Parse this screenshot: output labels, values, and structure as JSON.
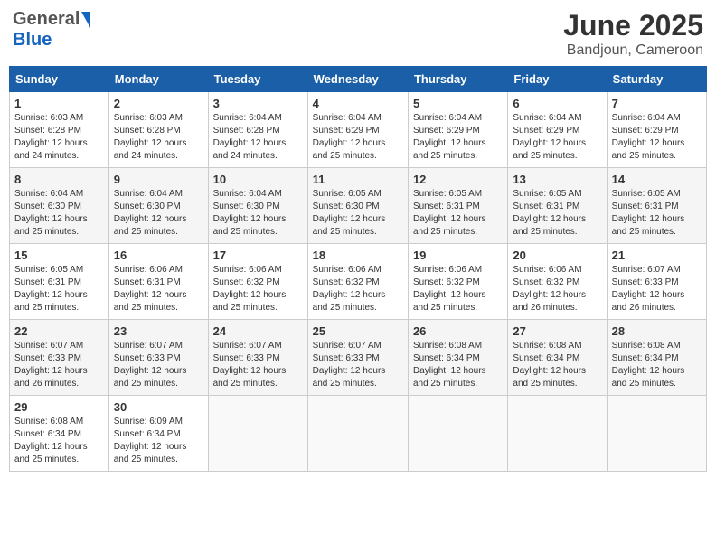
{
  "header": {
    "logo_general": "General",
    "logo_blue": "Blue",
    "month_title": "June 2025",
    "location": "Bandjoun, Cameroon"
  },
  "days_of_week": [
    "Sunday",
    "Monday",
    "Tuesday",
    "Wednesday",
    "Thursday",
    "Friday",
    "Saturday"
  ],
  "weeks": [
    [
      {
        "day": "1",
        "sunrise": "6:03 AM",
        "sunset": "6:28 PM",
        "daylight": "12 hours and 24 minutes."
      },
      {
        "day": "2",
        "sunrise": "6:03 AM",
        "sunset": "6:28 PM",
        "daylight": "12 hours and 24 minutes."
      },
      {
        "day": "3",
        "sunrise": "6:04 AM",
        "sunset": "6:28 PM",
        "daylight": "12 hours and 24 minutes."
      },
      {
        "day": "4",
        "sunrise": "6:04 AM",
        "sunset": "6:29 PM",
        "daylight": "12 hours and 25 minutes."
      },
      {
        "day": "5",
        "sunrise": "6:04 AM",
        "sunset": "6:29 PM",
        "daylight": "12 hours and 25 minutes."
      },
      {
        "day": "6",
        "sunrise": "6:04 AM",
        "sunset": "6:29 PM",
        "daylight": "12 hours and 25 minutes."
      },
      {
        "day": "7",
        "sunrise": "6:04 AM",
        "sunset": "6:29 PM",
        "daylight": "12 hours and 25 minutes."
      }
    ],
    [
      {
        "day": "8",
        "sunrise": "6:04 AM",
        "sunset": "6:30 PM",
        "daylight": "12 hours and 25 minutes."
      },
      {
        "day": "9",
        "sunrise": "6:04 AM",
        "sunset": "6:30 PM",
        "daylight": "12 hours and 25 minutes."
      },
      {
        "day": "10",
        "sunrise": "6:04 AM",
        "sunset": "6:30 PM",
        "daylight": "12 hours and 25 minutes."
      },
      {
        "day": "11",
        "sunrise": "6:05 AM",
        "sunset": "6:30 PM",
        "daylight": "12 hours and 25 minutes."
      },
      {
        "day": "12",
        "sunrise": "6:05 AM",
        "sunset": "6:31 PM",
        "daylight": "12 hours and 25 minutes."
      },
      {
        "day": "13",
        "sunrise": "6:05 AM",
        "sunset": "6:31 PM",
        "daylight": "12 hours and 25 minutes."
      },
      {
        "day": "14",
        "sunrise": "6:05 AM",
        "sunset": "6:31 PM",
        "daylight": "12 hours and 25 minutes."
      }
    ],
    [
      {
        "day": "15",
        "sunrise": "6:05 AM",
        "sunset": "6:31 PM",
        "daylight": "12 hours and 25 minutes."
      },
      {
        "day": "16",
        "sunrise": "6:06 AM",
        "sunset": "6:31 PM",
        "daylight": "12 hours and 25 minutes."
      },
      {
        "day": "17",
        "sunrise": "6:06 AM",
        "sunset": "6:32 PM",
        "daylight": "12 hours and 25 minutes."
      },
      {
        "day": "18",
        "sunrise": "6:06 AM",
        "sunset": "6:32 PM",
        "daylight": "12 hours and 25 minutes."
      },
      {
        "day": "19",
        "sunrise": "6:06 AM",
        "sunset": "6:32 PM",
        "daylight": "12 hours and 25 minutes."
      },
      {
        "day": "20",
        "sunrise": "6:06 AM",
        "sunset": "6:32 PM",
        "daylight": "12 hours and 26 minutes."
      },
      {
        "day": "21",
        "sunrise": "6:07 AM",
        "sunset": "6:33 PM",
        "daylight": "12 hours and 26 minutes."
      }
    ],
    [
      {
        "day": "22",
        "sunrise": "6:07 AM",
        "sunset": "6:33 PM",
        "daylight": "12 hours and 26 minutes."
      },
      {
        "day": "23",
        "sunrise": "6:07 AM",
        "sunset": "6:33 PM",
        "daylight": "12 hours and 25 minutes."
      },
      {
        "day": "24",
        "sunrise": "6:07 AM",
        "sunset": "6:33 PM",
        "daylight": "12 hours and 25 minutes."
      },
      {
        "day": "25",
        "sunrise": "6:07 AM",
        "sunset": "6:33 PM",
        "daylight": "12 hours and 25 minutes."
      },
      {
        "day": "26",
        "sunrise": "6:08 AM",
        "sunset": "6:34 PM",
        "daylight": "12 hours and 25 minutes."
      },
      {
        "day": "27",
        "sunrise": "6:08 AM",
        "sunset": "6:34 PM",
        "daylight": "12 hours and 25 minutes."
      },
      {
        "day": "28",
        "sunrise": "6:08 AM",
        "sunset": "6:34 PM",
        "daylight": "12 hours and 25 minutes."
      }
    ],
    [
      {
        "day": "29",
        "sunrise": "6:08 AM",
        "sunset": "6:34 PM",
        "daylight": "12 hours and 25 minutes."
      },
      {
        "day": "30",
        "sunrise": "6:09 AM",
        "sunset": "6:34 PM",
        "daylight": "12 hours and 25 minutes."
      },
      null,
      null,
      null,
      null,
      null
    ]
  ],
  "labels": {
    "sunrise": "Sunrise:",
    "sunset": "Sunset:",
    "daylight": "Daylight:"
  }
}
